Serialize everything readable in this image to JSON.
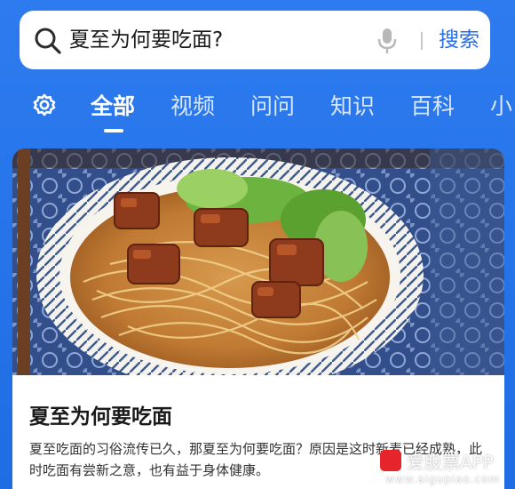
{
  "search": {
    "query": "夏至为何要吃面?",
    "button_label": "搜索"
  },
  "tabs": [
    {
      "label": "全部",
      "active": true
    },
    {
      "label": "视频",
      "active": false
    },
    {
      "label": "问问",
      "active": false
    },
    {
      "label": "知识",
      "active": false
    },
    {
      "label": "百科",
      "active": false
    },
    {
      "label": "小",
      "active": false
    }
  ],
  "card": {
    "image_icon": "noodle-bowl-photo",
    "title": "夏至为何要吃面",
    "description": "夏至吃面的习俗流传已久，那夏至为何要吃面？原因是这时新麦已经成熟，此时吃面有尝新之意，也有益于身体健康。"
  },
  "watermark": {
    "brand": "爱股票APP",
    "url": "www.aigupiao.com"
  },
  "colors": {
    "background": "#2473e8",
    "search_accent": "#2a6ee6",
    "card": "#ffffff",
    "watermark_logo": "#e5242b"
  }
}
